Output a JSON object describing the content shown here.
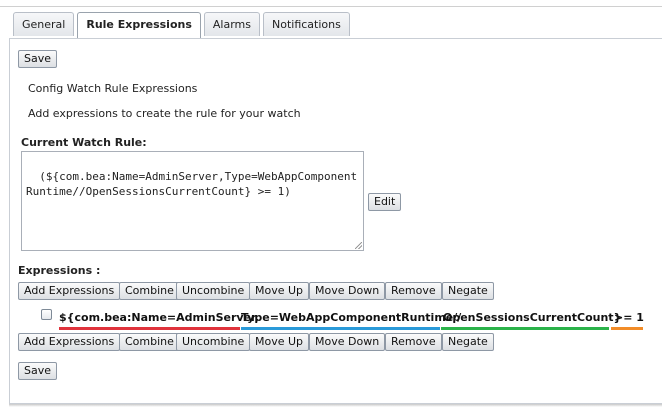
{
  "tabs": [
    "General",
    "Rule Expressions",
    "Alarms",
    "Notifications"
  ],
  "active_tab": "Rule Expressions",
  "save_label": "Save",
  "heading": "Config Watch Rule Expressions",
  "description": "Add expressions to create the rule for your watch",
  "current_rule_label": "Current Watch Rule:",
  "current_rule_value": "(${com.bea:Name=AdminServer,Type=WebAppComponentRuntime//OpenSessionsCurrentCount} >= 1)",
  "edit_label": "Edit",
  "expressions_label": "Expressions :",
  "toolbar": {
    "add": "Add Expressions",
    "combine": "Combine",
    "uncombine": "Uncombine",
    "move_up": "Move Up",
    "move_down": "Move Down",
    "remove": "Remove",
    "negate": "Negate"
  },
  "expression": {
    "part1": "${com.bea:Name=AdminServer,",
    "part2": "Type=WebAppComponentRuntime//",
    "part3": "OpenSessionsCurrentCount}",
    "part4": ">= 1"
  },
  "underline_colors": [
    "#e0333c",
    "#2a9ad9",
    "#2bb34a",
    "#f28c28"
  ]
}
